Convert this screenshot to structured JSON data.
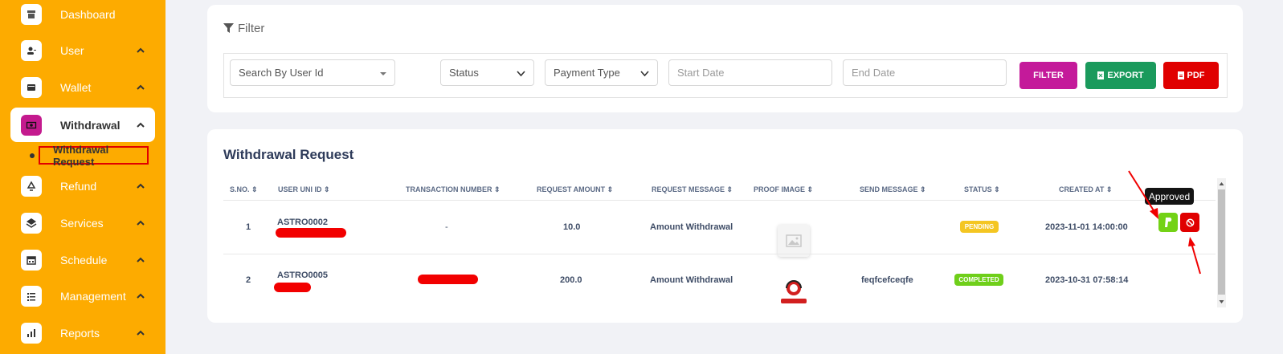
{
  "sidebar": {
    "items": [
      {
        "label": "Dashboard"
      },
      {
        "label": "User"
      },
      {
        "label": "Wallet"
      },
      {
        "label": "Withdrawal"
      },
      {
        "label": "Refund"
      },
      {
        "label": "Services"
      },
      {
        "label": "Schedule"
      },
      {
        "label": "Management"
      },
      {
        "label": "Reports"
      }
    ],
    "sub_item": "Withdrawal Request"
  },
  "filter": {
    "title": "Filter",
    "user_placeholder": "Search By User Id",
    "status": "Status",
    "payment_type": "Payment Type",
    "start_date": "Start Date",
    "end_date": "End Date",
    "filter_btn": "FILTER",
    "export_btn": "EXPORT",
    "pdf_btn": "PDF"
  },
  "table": {
    "title": "Withdrawal Request",
    "headers": [
      "S.NO.",
      "USER UNI ID",
      "TRANSACTION NUMBER",
      "REQUEST AMOUNT",
      "REQUEST MESSAGE",
      "PROOF IMAGE",
      "SEND MESSAGE",
      "STATUS",
      "CREATED AT"
    ],
    "rows": [
      {
        "sno": "1",
        "user_uni_id": "ASTRO0002",
        "transaction": "-",
        "amount": "10.0",
        "message": "Amount Withdrawal",
        "send_message": "",
        "status": "PENDING",
        "created_at": "2023-11-01 14:00:00"
      },
      {
        "sno": "2",
        "user_uni_id": "ASTRO0005",
        "transaction": "",
        "amount": "200.0",
        "message": "Amount Withdrawal",
        "send_message": "feqfcefceqfe",
        "status": "COMPLETED",
        "created_at": "2023-10-31 07:58:14"
      }
    ],
    "tooltip": "Approved"
  },
  "colors": {
    "sidebar": "#fdab00",
    "filter_btn": "#c41a9a",
    "export_btn": "#1a9a5c",
    "pdf_btn": "#e00000",
    "pending": "#f4c622",
    "completed": "#6fcf1a",
    "approve": "#73d216",
    "reject": "#e00000"
  }
}
